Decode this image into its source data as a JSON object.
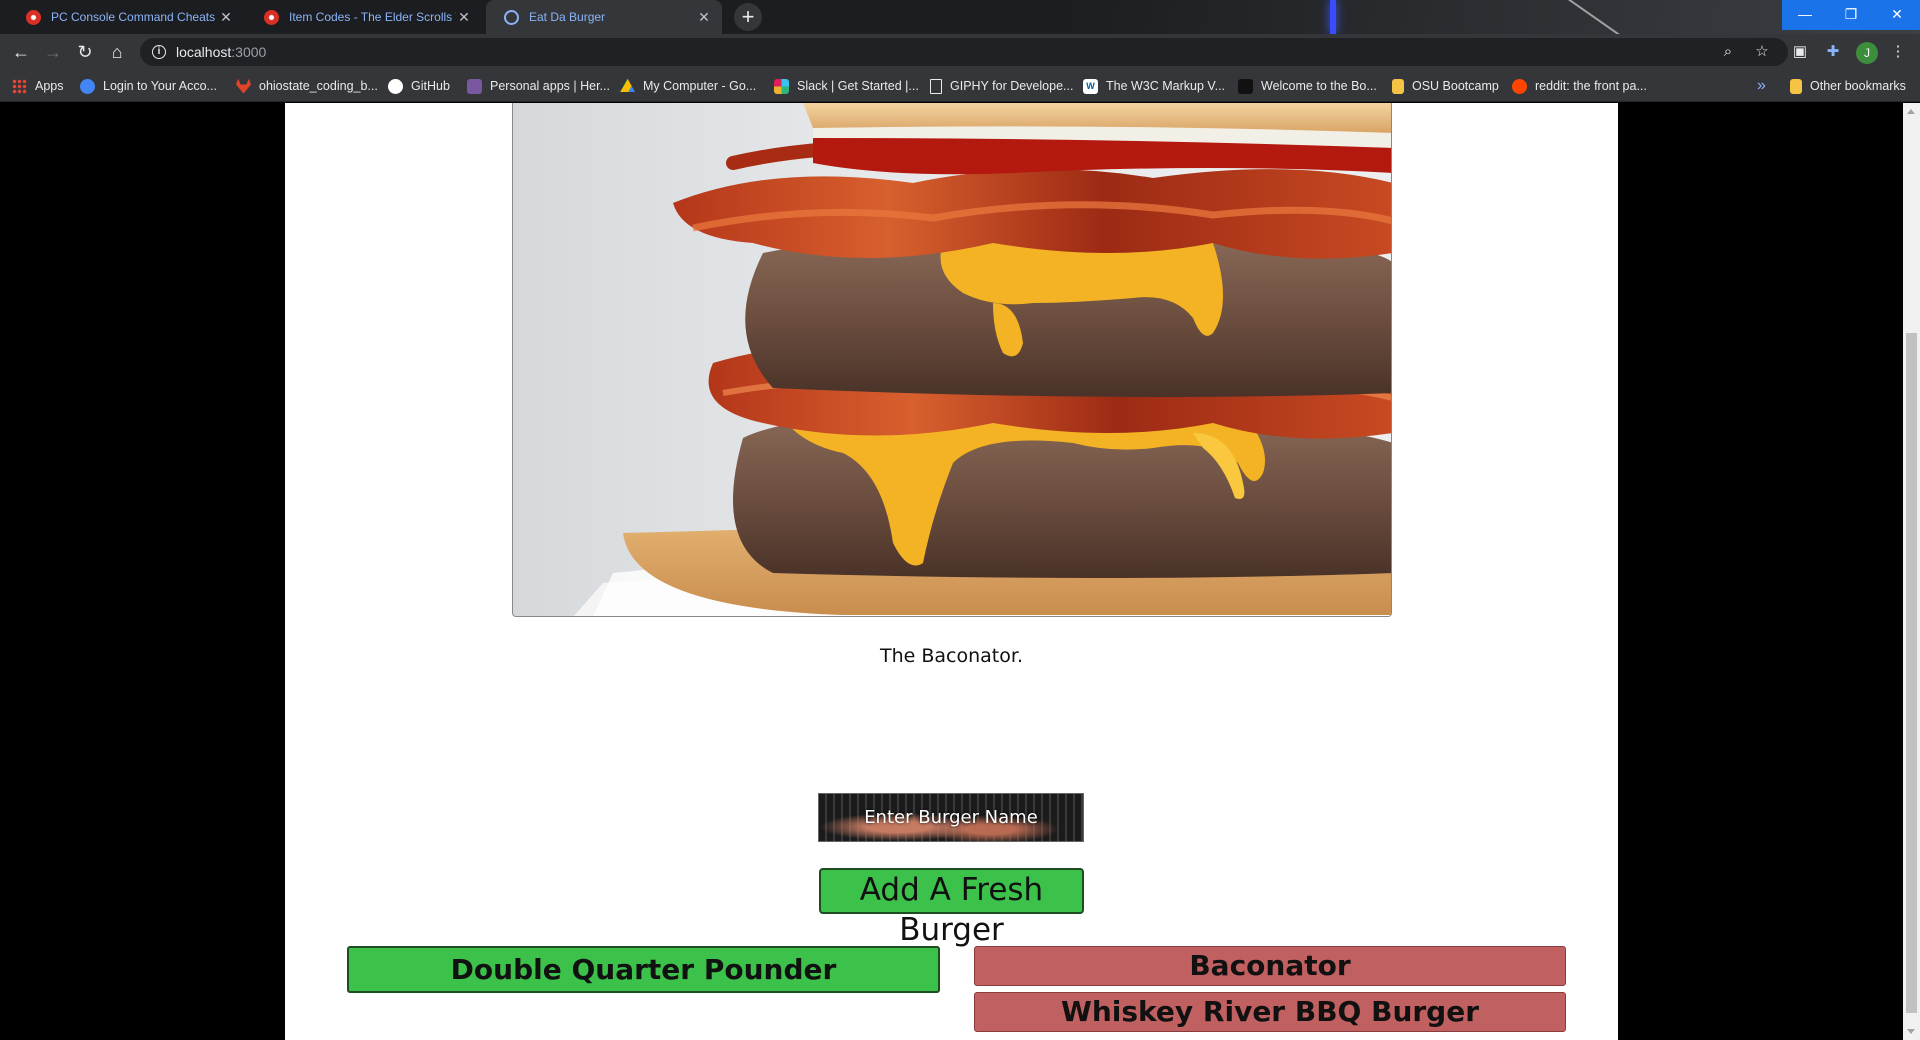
{
  "browser": {
    "tabs": [
      {
        "title": "PC Console Command Cheats - T",
        "icon": "red-paw-icon",
        "active": false
      },
      {
        "title": "Item Codes - The Elder Scrolls V",
        "icon": "red-paw-icon",
        "active": false
      },
      {
        "title": "Eat Da Burger",
        "icon": "globe-icon",
        "active": true
      }
    ],
    "new_tab": "+",
    "window_controls": {
      "minimize": "—",
      "restore": "❐",
      "close": "✕"
    },
    "url_host": "localhost",
    "url_port": ":3000",
    "profile_initial": "J",
    "bookmarks": [
      {
        "label": "Apps",
        "icon": "apps-grid-icon",
        "color": "#ea4335"
      },
      {
        "label": "Login to Your Acco...",
        "icon": "globe-icon",
        "color": "#4285f4"
      },
      {
        "label": "ohiostate_coding_b...",
        "icon": "gitlab-icon",
        "color": "#e24329"
      },
      {
        "label": "GitHub",
        "icon": "github-icon",
        "color": "#ffffff"
      },
      {
        "label": "Personal apps | Her...",
        "icon": "heroku-icon",
        "color": "#79589f"
      },
      {
        "label": "My Computer - Go...",
        "icon": "google-drive-icon",
        "color": "#fbbc04"
      },
      {
        "label": "Slack | Get Started |...",
        "icon": "slack-icon",
        "color": "#36c5f0"
      },
      {
        "label": "GIPHY for Develope...",
        "icon": "document-icon",
        "color": "#ffffff"
      },
      {
        "label": "The W3C Markup V...",
        "icon": "w3c-icon",
        "color": "#005a9c"
      },
      {
        "label": "Welcome to the Bo...",
        "icon": "bootstrap-icon",
        "color": "#222222"
      },
      {
        "label": "OSU Bootcamp",
        "icon": "folder-icon",
        "color": "#f6c445"
      },
      {
        "label": "reddit: the front pa...",
        "icon": "reddit-icon",
        "color": "#ff4500"
      }
    ],
    "bookmarks_overflow": "»",
    "other_bookmarks": "Other bookmarks"
  },
  "page": {
    "caption": "The Baconator.",
    "input_placeholder": "Enter Burger Name",
    "add_button": "Add A Fresh Burger",
    "uneaten_burgers": [
      "Double Quarter Pounder"
    ],
    "eaten_burgers": [
      "Baconator",
      "Whiskey River BBQ Burger"
    ],
    "colors": {
      "uneaten": "#3cc14b",
      "eaten": "#c16060"
    }
  }
}
